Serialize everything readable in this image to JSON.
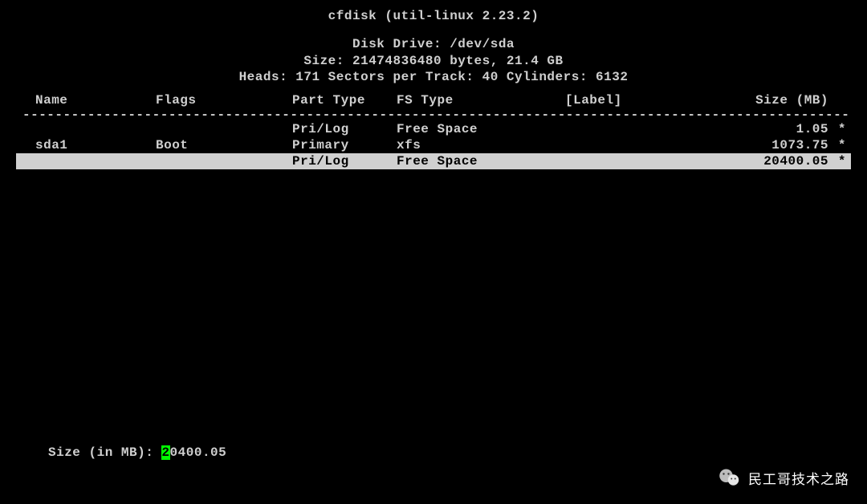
{
  "header": {
    "title": "cfdisk (util-linux 2.23.2)",
    "drive_line": "Disk Drive: /dev/sda",
    "size_line": "Size: 21474836480 bytes, 21.4 GB",
    "geom_line": "Heads: 171   Sectors per Track: 40   Cylinders: 6132"
  },
  "columns": {
    "name": "Name",
    "flags": "Flags",
    "ptype": "Part Type",
    "fstype": "FS Type",
    "label": "[Label]",
    "size": "Size (MB)"
  },
  "rows": [
    {
      "name": "",
      "flags": "",
      "ptype": "Pri/Log",
      "fstype": "Free Space",
      "label": "",
      "size": "1.05",
      "star": "*",
      "highlighted": false
    },
    {
      "name": "sda1",
      "flags": "Boot",
      "ptype": "Primary",
      "fstype": "xfs",
      "label": "",
      "size": "1073.75",
      "star": "*",
      "highlighted": false
    },
    {
      "name": "",
      "flags": "",
      "ptype": "Pri/Log",
      "fstype": "Free Space",
      "label": "",
      "size": "20400.05",
      "star": "*",
      "highlighted": true
    }
  ],
  "divider": "-----------------------------------------------------------------------------------------------------------",
  "prompt": {
    "label": "Size (in MB): ",
    "cursor_char": "2",
    "rest": "0400.05"
  },
  "watermark": {
    "text": "民工哥技术之路"
  }
}
